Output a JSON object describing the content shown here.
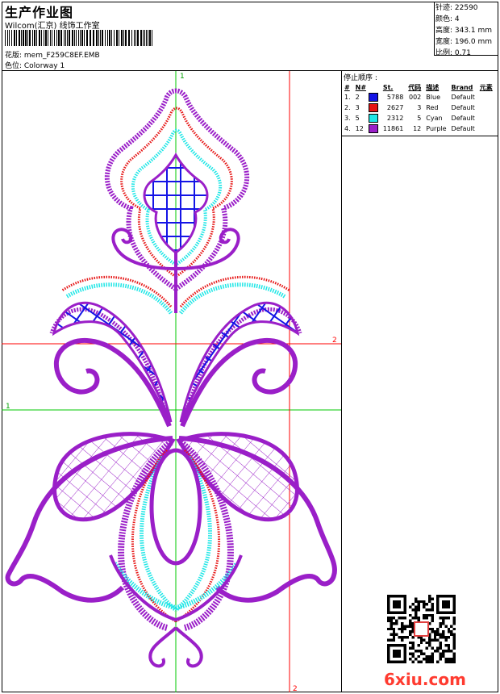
{
  "header": {
    "title": "生产作业图",
    "company": "Wilcom(汇京) 线饰工作室",
    "design_label": "花版: mem_F259C8EF.EMB",
    "colorway_label": "色位: Colorway 1"
  },
  "stats": {
    "stitches": "针迹: 22590",
    "colors": "颜色: 4",
    "height": "高度: 343.1 mm",
    "width": "宽度: 196.0 mm",
    "ratio": "比例: 0.71"
  },
  "stop_sequence": {
    "title": "停止顺序 :",
    "headers": [
      "#",
      "N#",
      "St.",
      "代码",
      "描述",
      "Brand",
      "元素"
    ],
    "rows": [
      {
        "idx": "1.",
        "n": "2",
        "color": "#1414e6",
        "st": "5788",
        "code": "002",
        "desc": "Blue",
        "brand": "Default"
      },
      {
        "idx": "2.",
        "n": "3",
        "color": "#e61414",
        "st": "2627",
        "code": "3",
        "desc": "Red",
        "brand": "Default"
      },
      {
        "idx": "3.",
        "n": "5",
        "color": "#1ee6e6",
        "st": "2312",
        "code": "5",
        "desc": "Cyan",
        "brand": "Default"
      },
      {
        "idx": "4.",
        "n": "12",
        "color": "#9a1fc8",
        "st": "11861",
        "code": "12",
        "desc": "Purple",
        "brand": "Default"
      }
    ]
  },
  "axis_labels": {
    "top": "1",
    "right": "2",
    "left": "1",
    "bottom": "2"
  },
  "watermark": "6xiu.com",
  "colors": {
    "guide_green": "#00c800",
    "guide_red": "#ff0000",
    "purple": "#9a1fc8",
    "blue": "#1414e6",
    "red": "#e61414",
    "cyan": "#1ee6e6"
  }
}
